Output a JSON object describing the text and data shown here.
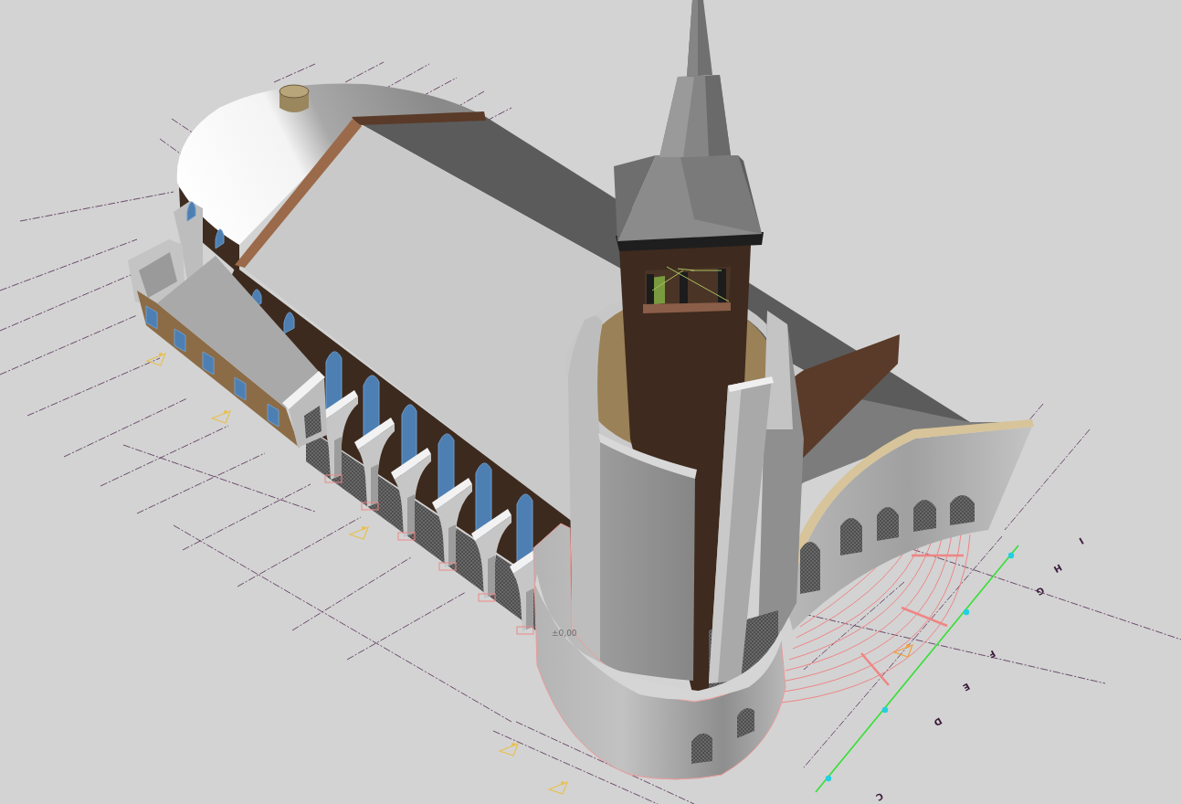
{
  "viewport": {
    "level_label": "±0,00",
    "grid_axis_labels": [
      "C",
      "D",
      "E",
      "F",
      "G",
      "H",
      "I"
    ]
  }
}
